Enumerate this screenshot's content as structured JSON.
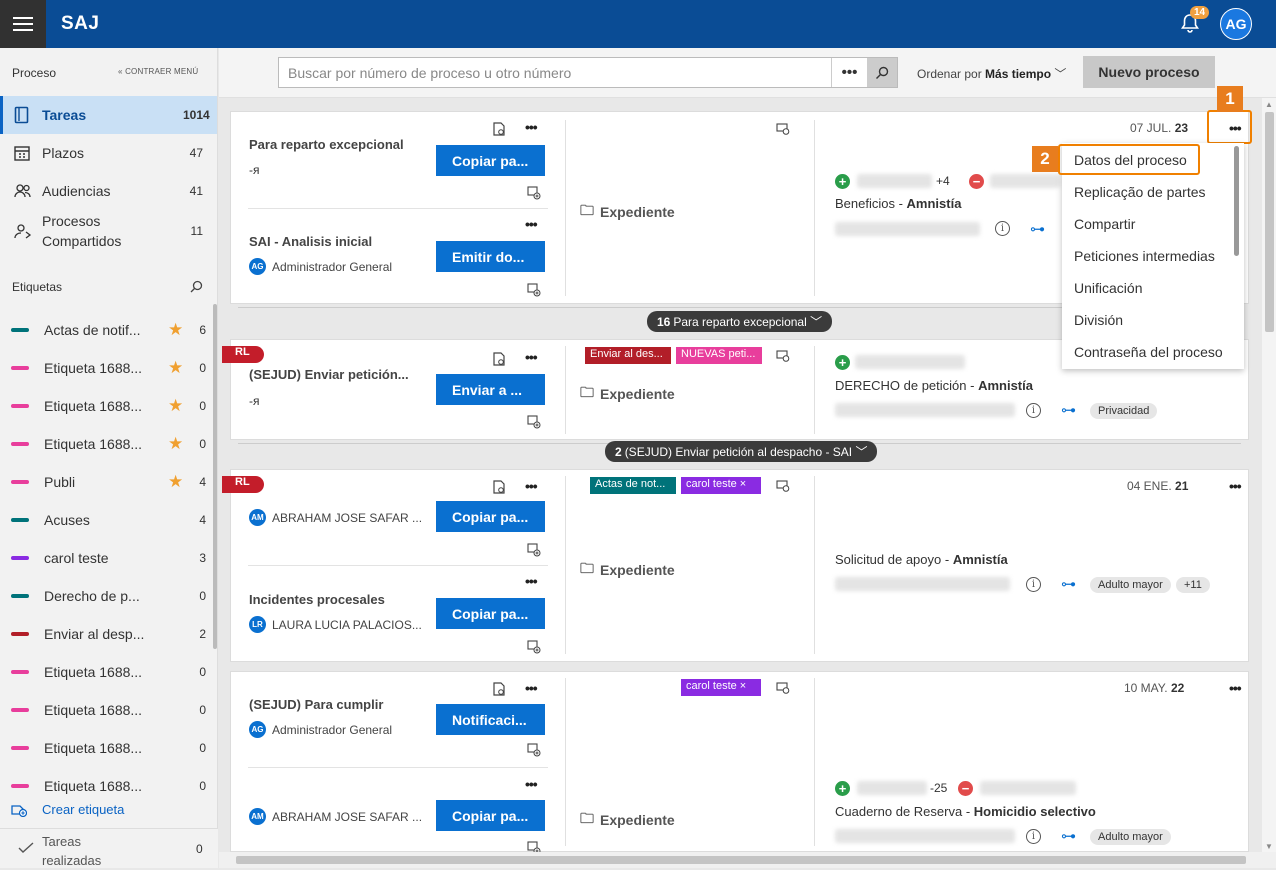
{
  "app": {
    "name": "SAJ",
    "notifications": "14",
    "user_initials": "AG"
  },
  "sidebar": {
    "section": "Proceso",
    "collapse": "CONTRAER MENÚ",
    "nav": [
      {
        "label": "Tareas",
        "count": "1014",
        "icon": "tasks-icon"
      },
      {
        "label": "Plazos",
        "count": "47",
        "icon": "calendar-icon"
      },
      {
        "label": "Audiencias",
        "count": "41",
        "icon": "people-icon"
      },
      {
        "label": "Procesos Compartidos",
        "count": "11",
        "icon": "shared-icon"
      }
    ],
    "tags_title": "Etiquetas",
    "tags": [
      {
        "label": "Actas de notif...",
        "count": "6",
        "color": "#00737a",
        "star": "★"
      },
      {
        "label": "Etiqueta 1688...",
        "count": "0",
        "color": "#e83e9c",
        "star": "★"
      },
      {
        "label": "Etiqueta 1688...",
        "count": "0",
        "color": "#e83e9c",
        "star": "★"
      },
      {
        "label": "Etiqueta 1688...",
        "count": "0",
        "color": "#e83e9c",
        "star": "★"
      },
      {
        "label": "Publi",
        "count": "4",
        "color": "#e83e9c",
        "star": "★"
      },
      {
        "label": "Acuses",
        "count": "4",
        "color": "#00737a",
        "star": ""
      },
      {
        "label": "carol teste",
        "count": "3",
        "color": "#8a2be2",
        "star": ""
      },
      {
        "label": "Derecho de p...",
        "count": "0",
        "color": "#00737a",
        "star": ""
      },
      {
        "label": "Enviar al desp...",
        "count": "2",
        "color": "#b21e28",
        "star": ""
      },
      {
        "label": "Etiqueta 1688...",
        "count": "0",
        "color": "#e83e9c",
        "star": ""
      },
      {
        "label": "Etiqueta 1688...",
        "count": "0",
        "color": "#e83e9c",
        "star": ""
      },
      {
        "label": "Etiqueta 1688...",
        "count": "0",
        "color": "#e83e9c",
        "star": ""
      },
      {
        "label": "Etiqueta 1688...",
        "count": "0",
        "color": "#e83e9c",
        "star": ""
      }
    ],
    "create_tag": "Crear etiqueta",
    "done": {
      "label": "Tareas realizadas",
      "count": "0"
    }
  },
  "toolbar": {
    "search_placeholder": "Buscar por número de proceso u otro número",
    "order_prefix": "Ordenar por",
    "order_value": "Más tiempo",
    "new_button": "Nuevo proceso"
  },
  "cards": [
    {
      "tasks": [
        {
          "title": "Para reparto excepcional",
          "action": "Copiar pa..."
        },
        {
          "title": "SAI - Analisis inicial",
          "person_initials": "AG",
          "person": "Administrador General",
          "action": "Emitir do..."
        }
      ],
      "expediente": "Expediente",
      "date_prefix": "07 JUL.",
      "date_year": "23",
      "more_parts": "+4",
      "proc_name": "Beneficios",
      "proc_type": "Amnistía",
      "group": {
        "count": "16",
        "label": "Para reparto excepcional"
      }
    },
    {
      "rl": "RL",
      "tags": [
        "Enviar al des...",
        "NUEVAS peti..."
      ],
      "tasks": [
        {
          "title": "(SEJUD) Enviar petición...",
          "action": "Enviar a ..."
        }
      ],
      "expediente": "Expediente",
      "proc_name": "DERECHO de petición",
      "proc_type": "Amnistía",
      "pill": "Privacidad",
      "group": {
        "count": "2",
        "label": "(SEJUD) Enviar petición al despacho - SAI"
      }
    },
    {
      "rl": "RL",
      "tags": [
        "Actas de not...",
        "carol teste"
      ],
      "tasks": [
        {
          "person_initials": "AM",
          "person": "ABRAHAM JOSE SAFAR ...",
          "action": "Copiar pa..."
        },
        {
          "title": "Incidentes procesales",
          "person_initials": "LR",
          "person": "LAURA LUCIA PALACIOS...",
          "action": "Copiar pa..."
        }
      ],
      "expediente": "Expediente",
      "date_prefix": "04 ENE.",
      "date_year": "21",
      "proc_name": "Solicitud de apoyo",
      "proc_type": "Amnistía",
      "pill": "Adulto mayor",
      "pill_more": "+11"
    },
    {
      "tags": [
        "carol teste"
      ],
      "tasks": [
        {
          "title": "(SEJUD) Para cumplir",
          "person_initials": "AG",
          "person": "Administrador General",
          "action": "Notificaci..."
        },
        {
          "person_initials": "AM",
          "person": "ABRAHAM JOSE SAFAR ...",
          "action": "Copiar pa..."
        }
      ],
      "expediente": "Expediente",
      "date_prefix": "10 MAY.",
      "date_year": "22",
      "part_suffix": "-25",
      "proc_name": "Cuaderno de Reserva",
      "proc_type": "Homicidio selectivo",
      "pill": "Adulto mayor"
    }
  ],
  "context_menu": [
    "Datos del proceso",
    "Replicação de partes",
    "Compartir",
    "Peticiones intermedias",
    "Unificación",
    "División",
    "Contraseña del proceso"
  ],
  "callouts": [
    "1",
    "2"
  ]
}
